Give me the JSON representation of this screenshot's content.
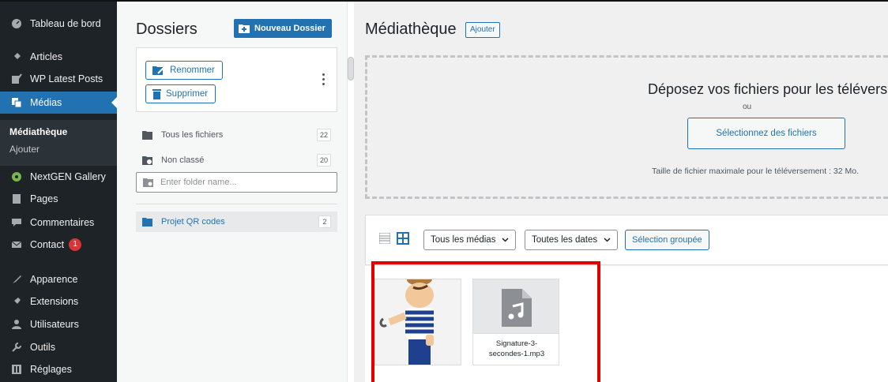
{
  "sidebar": {
    "items": [
      {
        "label": "Tableau de bord",
        "icon": "dashboard-icon"
      },
      {
        "label": "Articles",
        "icon": "pin-icon"
      },
      {
        "label": "WP Latest Posts",
        "icon": "edit-icon"
      },
      {
        "label": "Médias",
        "icon": "media-icon"
      },
      {
        "label": "NextGEN Gallery",
        "icon": "gallery-icon"
      },
      {
        "label": "Pages",
        "icon": "page-icon"
      },
      {
        "label": "Commentaires",
        "icon": "comment-icon"
      },
      {
        "label": "Contact",
        "icon": "mail-icon",
        "badge": "1"
      },
      {
        "label": "Apparence",
        "icon": "brush-icon"
      },
      {
        "label": "Extensions",
        "icon": "plugin-icon"
      },
      {
        "label": "Utilisateurs",
        "icon": "users-icon"
      },
      {
        "label": "Outils",
        "icon": "wrench-icon"
      },
      {
        "label": "Réglages",
        "icon": "settings-icon"
      }
    ],
    "submenu": {
      "current": "Médiathèque",
      "other": "Ajouter"
    }
  },
  "folders": {
    "title": "Dossiers",
    "new_folder_label": "Nouveau Dossier",
    "rename_label": "Renommer",
    "delete_label": "Supprimer",
    "rows": [
      {
        "label": "Tous les fichiers",
        "count": "22"
      },
      {
        "label": "Non classé",
        "count": "20"
      }
    ],
    "input_placeholder": "Enter folder name...",
    "project": {
      "label": "Projet QR codes",
      "count": "2"
    }
  },
  "media": {
    "title": "Médiathèque",
    "add_label": "Ajouter",
    "dropzone": {
      "title": "Déposez vos fichiers pour les téléverser",
      "or": "ou",
      "select_label": "Sélectionnez des fichiers",
      "max_size": "Taille de fichier maximale pour le téléversement : 32 Mo."
    },
    "filters": {
      "type": "Tous les médias",
      "dates": "Toutes les dates",
      "bulk": "Sélection groupée"
    },
    "files": [
      {
        "name": "",
        "type": "image"
      },
      {
        "name_line1": "Signature-3-",
        "name_line2": "secondes-1.mp3",
        "type": "audio"
      }
    ]
  },
  "colors": {
    "accent": "#2271b1",
    "sidebar": "#1d2327",
    "highlight": "#e00000"
  }
}
